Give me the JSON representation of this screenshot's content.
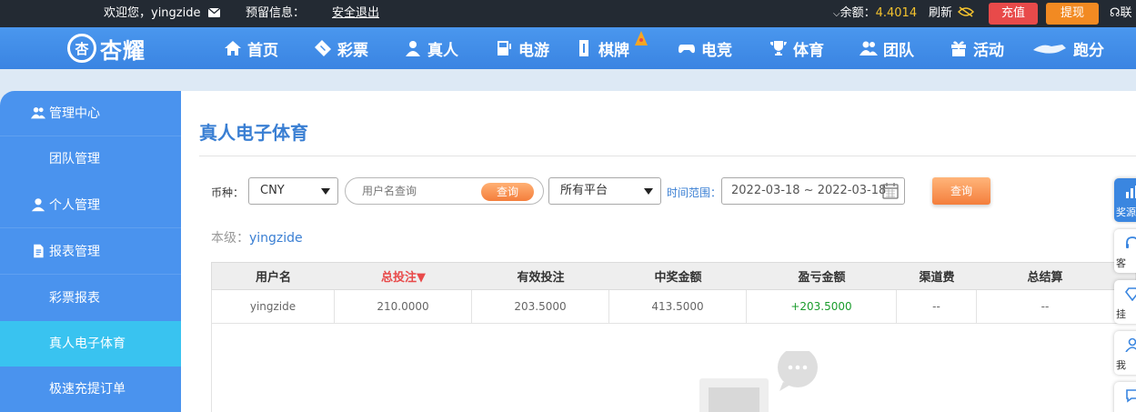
{
  "topbar": {
    "welcome": "欢迎您，yingzide",
    "reserved_label": "预留信息：",
    "logout": "安全退出",
    "balance_label": "余额：",
    "balance_value": "4.4014",
    "refresh": "刷新",
    "recharge": "充值",
    "withdraw": "提现",
    "contact": "联"
  },
  "logo": {
    "text": "杏耀",
    "mark": "杏"
  },
  "nav": [
    {
      "label": "首页",
      "icon": "home-icon"
    },
    {
      "label": "彩票",
      "icon": "ticket-icon"
    },
    {
      "label": "真人",
      "icon": "dealer-icon"
    },
    {
      "label": "电游",
      "icon": "arcade-icon"
    },
    {
      "label": "棋牌",
      "icon": "cards-icon"
    },
    {
      "label": "电竞",
      "icon": "gamepad-icon"
    },
    {
      "label": "体育",
      "icon": "trophy-icon"
    },
    {
      "label": "团队",
      "icon": "team-icon"
    },
    {
      "label": "活动",
      "icon": "gift-icon"
    },
    {
      "label": "跑分",
      "icon": "runner-icon"
    }
  ],
  "sidebar": {
    "items": [
      {
        "label": "管理中心",
        "type": "group",
        "icon": "team-icon"
      },
      {
        "label": "团队管理",
        "type": "sub"
      },
      {
        "label": "个人管理",
        "type": "group",
        "icon": "user-icon"
      },
      {
        "label": "报表管理",
        "type": "group",
        "icon": "report-icon"
      },
      {
        "label": "彩票报表",
        "type": "sub"
      },
      {
        "label": "真人电子体育",
        "type": "sub",
        "active": true
      },
      {
        "label": "极速充提订单",
        "type": "sub"
      }
    ]
  },
  "main": {
    "title": "真人电子体育",
    "filters": {
      "currency_label": "币种：",
      "currency_value": "CNY",
      "username_placeholder": "用户名查询",
      "search_button": "查询",
      "platform_value": "所有平台",
      "time_label": "时间范围：",
      "date_range": "2022-03-18 ~ 2022-03-18",
      "query_button": "查询"
    },
    "level_label": "本级：",
    "level_user": "yingzide",
    "table": {
      "headers": [
        "用户名",
        "总投注▼",
        "有效投注",
        "中奖金额",
        "盈亏金额",
        "渠道费",
        "总结算"
      ],
      "rows": [
        [
          "yingzide",
          "210.0000",
          "203.5000",
          "413.5000",
          "+203.5000",
          "--",
          "--"
        ]
      ]
    }
  },
  "float_tools": [
    {
      "label": "奖源",
      "icon": "chart-icon"
    },
    {
      "label": "客",
      "icon": "headset-icon"
    },
    {
      "label": "挂",
      "icon": "diamond-icon"
    },
    {
      "label": "我",
      "icon": "person-icon"
    },
    {
      "label": "",
      "icon": "chat-icon"
    }
  ],
  "colors": {
    "topbar_bg": "#232a33",
    "nav_blue": "#3a84e2",
    "sidebar_blue": "#4a93ee",
    "sidebar_active": "#39c3f0",
    "title_blue": "#3a7fd3",
    "recharge_red": "#e84a4a",
    "withdraw_orange": "#f28a22",
    "profit_green": "#1a9c2c"
  }
}
